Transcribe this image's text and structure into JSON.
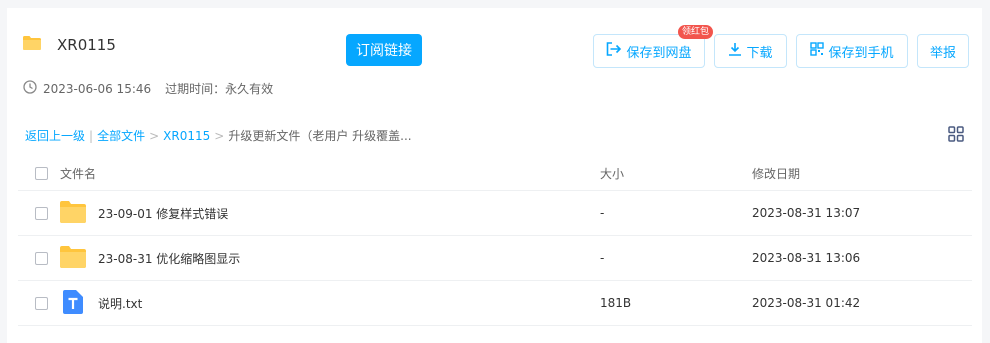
{
  "header": {
    "folder_name": "XR0115",
    "subscribe_label": "订阅链接",
    "save_to_disk_label": "保存到网盘",
    "badge_label": "领红包",
    "download_label": "下载",
    "save_to_phone_label": "保存到手机",
    "report_label": "举报"
  },
  "meta": {
    "created": "2023-06-06 15:46",
    "expire_label": "过期时间：永久有效"
  },
  "breadcrumb": {
    "back": "返回上一级",
    "all_files": "全部文件",
    "folder": "XR0115",
    "current": "升级更新文件（老用户 升级覆盖..."
  },
  "table": {
    "col_name": "文件名",
    "col_size": "大小",
    "col_date": "修改日期",
    "rows": [
      {
        "name": "23-09-01 修复样式错误",
        "size": "-",
        "date": "2023-08-31 13:07",
        "icon": "folder-icon"
      },
      {
        "name": "23-08-31 优化缩略图显示",
        "size": "-",
        "date": "2023-08-31 13:06",
        "icon": "folder-icon"
      },
      {
        "name": "说明.txt",
        "size": "181B",
        "date": "2023-08-31 01:42",
        "icon": "txt-file-icon"
      }
    ]
  },
  "colors": {
    "accent": "#06a7ff",
    "folder": "#ffc53d",
    "badge": "#f2554d",
    "txt": "#3f8cff"
  }
}
